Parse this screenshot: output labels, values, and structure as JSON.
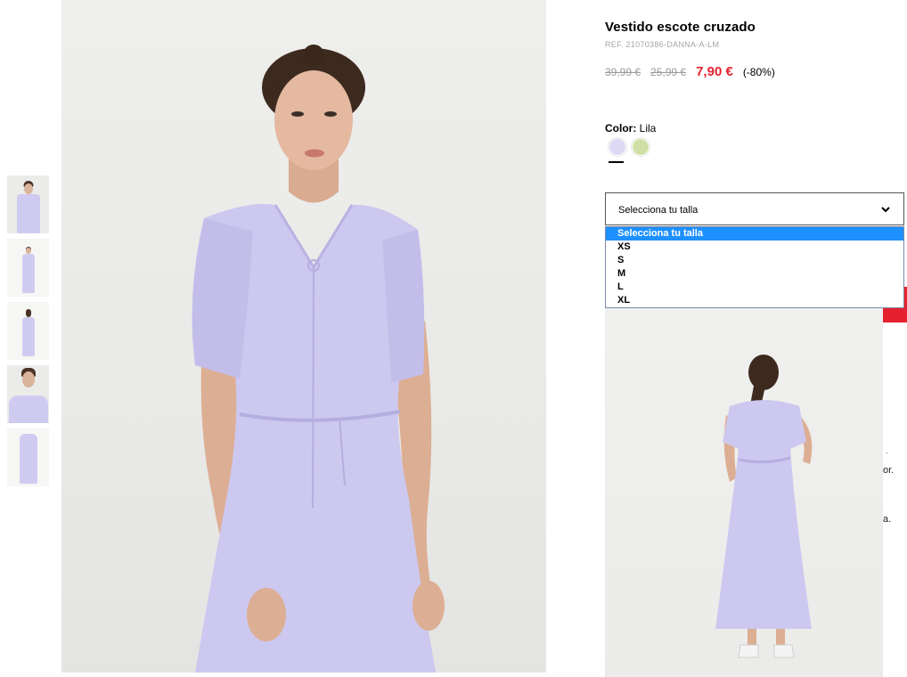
{
  "product": {
    "title": "Vestido escote cruzado",
    "ref": "REF. 21070386-DANNA-A-LM",
    "price_original": "39,99 €",
    "price_previous": "25,99 €",
    "price_current": "7,90 €",
    "discount": "(-80%)"
  },
  "color": {
    "label": "Color:",
    "value": "Lila",
    "swatches": [
      {
        "name": "Lila",
        "hex": "#ddd8f4",
        "selected": true
      },
      {
        "name": "Verde",
        "hex": "#cfe0a6",
        "selected": false
      }
    ]
  },
  "size": {
    "placeholder": "Selecciona tu talla",
    "options": [
      "Selecciona tu talla",
      "XS",
      "S",
      "M",
      "L",
      "XL"
    ],
    "highlighted_index": 0
  },
  "edge_text": [
    "or.",
    "a."
  ],
  "colors": {
    "accent_red": "#e5212f",
    "dress_lilac": "#cdc8ef",
    "highlight_blue": "#1e90ff"
  }
}
